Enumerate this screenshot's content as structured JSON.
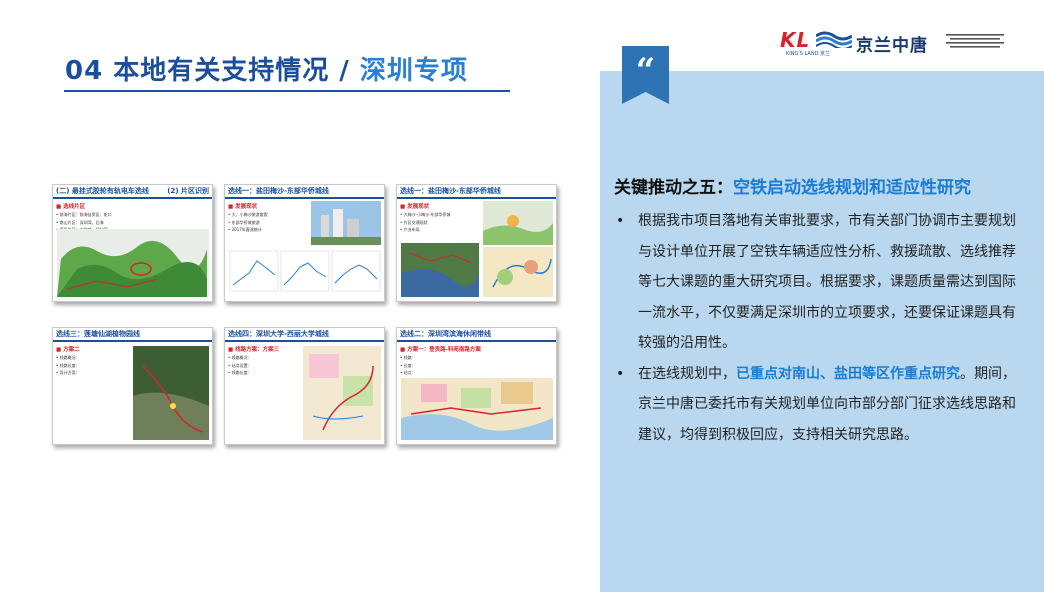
{
  "header": {
    "title_main": "04 本地有关支持情况 / ",
    "title_accent": "深圳专项"
  },
  "logo": {
    "mark": "KL",
    "mark_sub": "KING'S LAND 京兰",
    "company": "京兰中唐"
  },
  "thumbnails": [
    {
      "title": "(二) 悬挂式胶轮有轨电车选线",
      "title_right": "(2) 片区识别",
      "section": "■ 选线片区",
      "lines": [
        "• 前海片区：前海自贸区、蛇口",
        "• 南山片区：深圳湾、后海",
        "• 西丽片区：大学城、留仙洞"
      ]
    },
    {
      "title": "选线一：盐田梅沙-东部华侨城线",
      "section": "■ 发展现状",
      "lines": [
        "• 大、小梅沙旅游度假",
        "• 东部华侨城旅游",
        "• 2017年客流统计"
      ]
    },
    {
      "title": "选线一：盐田梅沙-东部华侨城线",
      "section": "■ 发展现状",
      "lines": [
        "• 大梅沙-小梅沙-东部华侨城",
        "• 片区交通现状",
        "• 产业布局"
      ]
    },
    {
      "title": "选线三：莲塘仙湖植物园线",
      "section": "■ 方案二",
      "lines": [
        "• 线路概况：",
        "• 线路长度：",
        "• 设计方案："
      ]
    },
    {
      "title": "选线四：深圳大学-西丽大学城线",
      "section": "■ 线路方案：方案三",
      "lines": [
        "• 线路概况：",
        "• 站点设置：",
        "• 线路长度："
      ]
    },
    {
      "title": "选线二：深圳湾滨海休闲带线",
      "section": "■ 方案一：登良路-科苑南路方案",
      "lines": [
        "• 线路：",
        "• 长度：",
        "• 站点："
      ]
    }
  ],
  "panel": {
    "heading_prefix": "关键推动之五：",
    "heading_accent": "空铁启动选线规划和适应性研究",
    "bullet1": "根据我市项目落地有关审批要求，市有关部门协调市主要规划与设计单位开展了空铁车辆适应性分析、救援疏散、选线推荐等七大课题的重大研究项目。根据要求，课题质量需达到国际一流水平，不仅要满足深圳市的立项要求，还要保证课题具有较强的沿用性。",
    "bullet2_before": "在选线规划中，",
    "bullet2_accent": "已重点对南山、盐田等区作重点研究",
    "bullet2_after": "。期间，京兰中唐已委托市有关规划单位向市部分部门征求选线思路和建议，均得到积极回应，支持相关研究思路。"
  },
  "colors": {
    "brand_blue": "#1b4f9c",
    "accent_blue": "#2b7fd0",
    "highlight_blue": "#1a7cd3",
    "panel_bg": "#b9d8ef",
    "logo_red": "#d6242a"
  }
}
